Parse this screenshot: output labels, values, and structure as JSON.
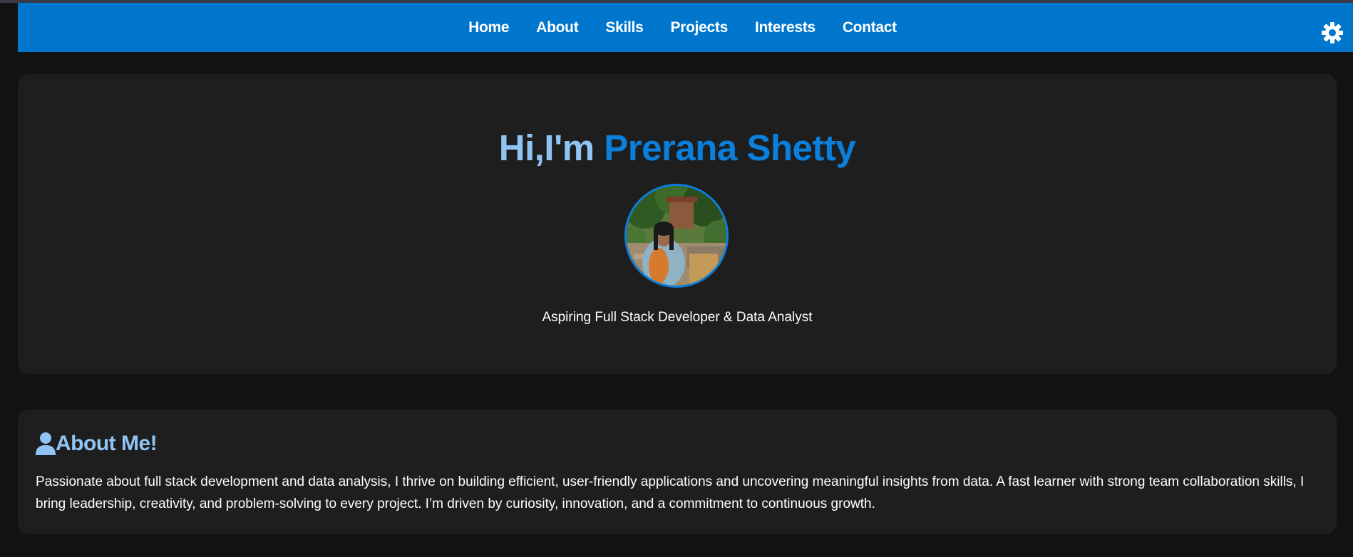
{
  "nav": {
    "links": [
      {
        "label": "Home"
      },
      {
        "label": "About"
      },
      {
        "label": "Skills"
      },
      {
        "label": "Projects"
      },
      {
        "label": "Interests"
      },
      {
        "label": "Contact"
      }
    ],
    "theme_toggle_icon": "gear-icon"
  },
  "hero": {
    "greeting": "Hi,I'm",
    "name": "Prerana Shetty",
    "subtitle": "Aspiring Full Stack Developer & Data Analyst",
    "avatar_icon": "profile-photo"
  },
  "about": {
    "icon": "user-icon",
    "title": "About Me!",
    "text": "Passionate about full stack development and data analysis, I thrive on building efficient, user-friendly applications and uncovering meaningful insights from data. A fast learner with strong team collaboration skills, I bring leadership, creativity, and problem-solving to every project. I’m driven by curiosity, innovation, and a commitment to continuous growth."
  },
  "colors": {
    "accent": "#0077cc",
    "name_blue": "#0a7fdc",
    "light_blue": "#8fc4f5",
    "card_bg": "#1e1e1e",
    "page_bg": "#121212"
  }
}
